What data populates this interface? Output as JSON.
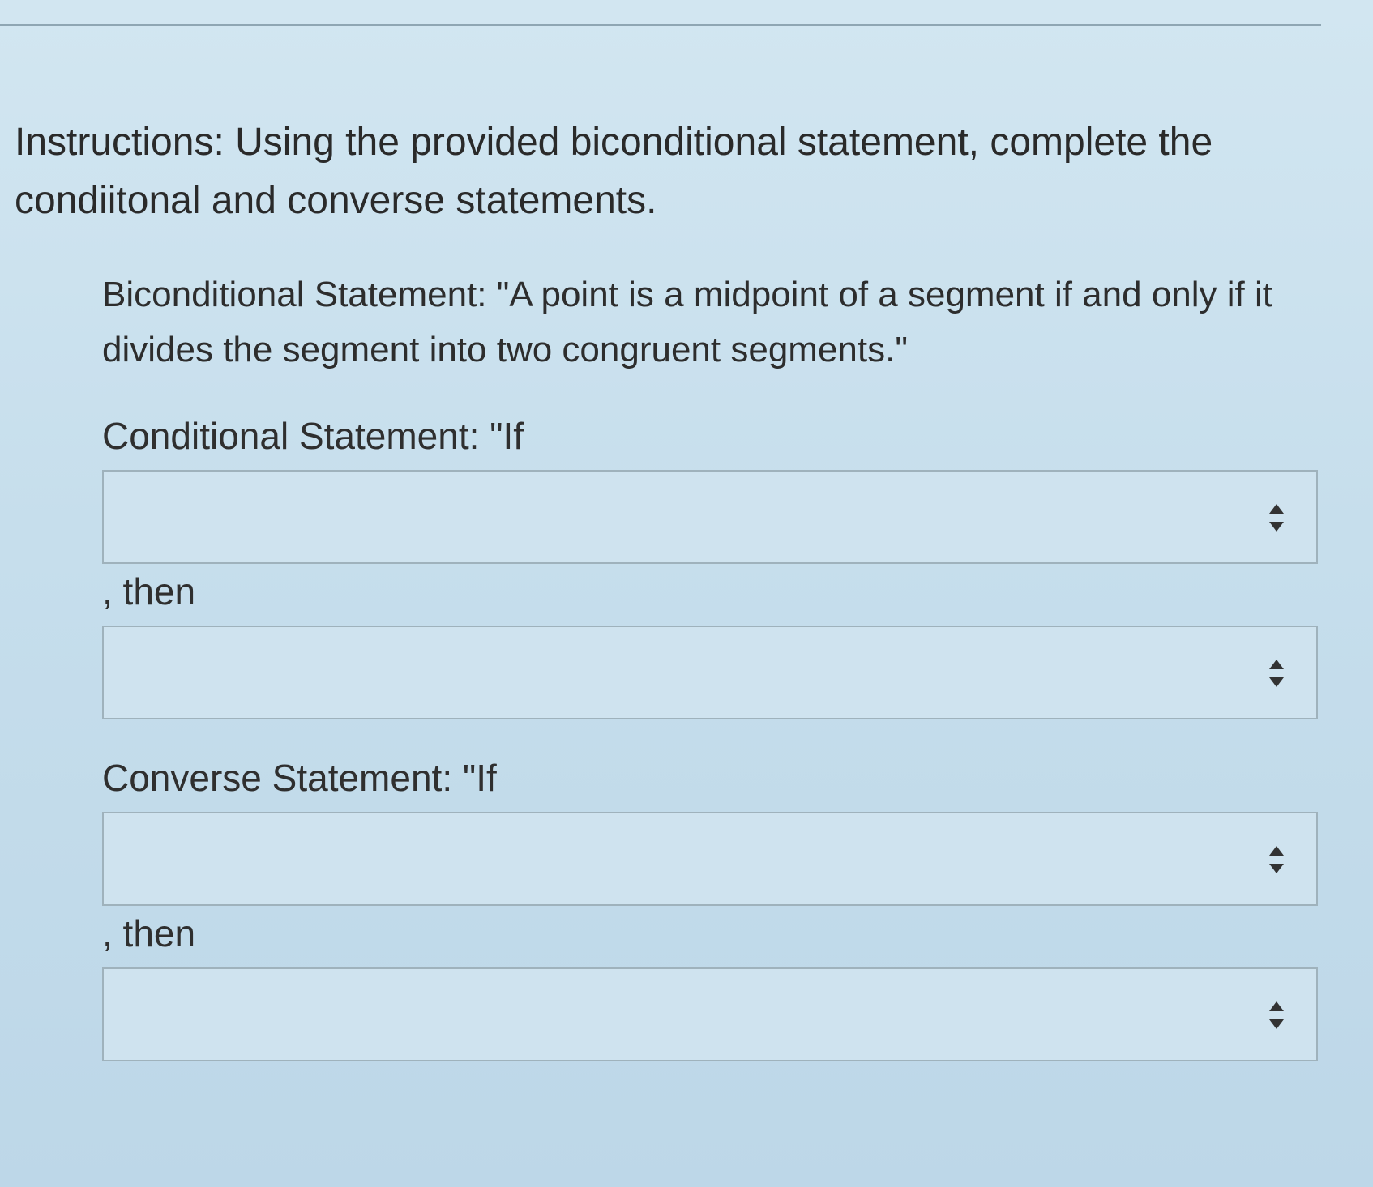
{
  "instructions": "Instructions: Using the provided biconditional statement, complete the condiitonal and converse statements.",
  "biconditional": "Biconditional Statement: \"A point is a midpoint of a segment if and only if it divides the segment into two congruent segments.\"",
  "conditional": {
    "label": "Conditional Statement: \"If",
    "then_label": ", then",
    "if_select": {
      "value": ""
    },
    "then_select": {
      "value": ""
    }
  },
  "converse": {
    "label": "Converse Statement: \"If",
    "then_label": ", then",
    "if_select": {
      "value": ""
    },
    "then_select": {
      "value": ""
    }
  }
}
